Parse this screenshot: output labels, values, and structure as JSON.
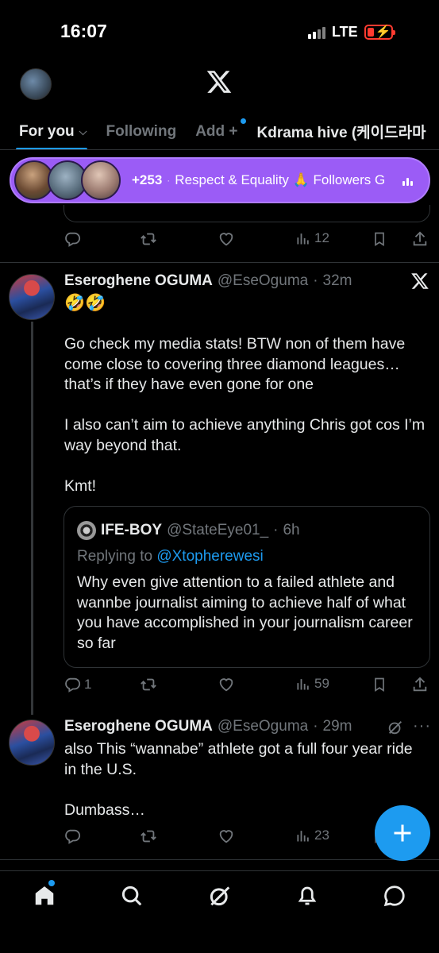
{
  "status_bar": {
    "time": "16:07",
    "network": "LTE"
  },
  "tabs": [
    {
      "label": "For you",
      "active": true
    },
    {
      "label": "Following"
    },
    {
      "label": "Add +"
    },
    {
      "label": "Kdrama hive (케이드라마"
    }
  ],
  "space_pill": {
    "count": "+253",
    "title": "Respect & Equality 🙏 Followers G"
  },
  "prev_tweet": {
    "views": "12"
  },
  "tweet1": {
    "name": "Eseroghene OGUMA",
    "handle": "@EseOguma",
    "time": "32m",
    "emojis": "🤣🤣",
    "body": "Go check my media stats! BTW non of them have come close to covering three diamond leagues… that’s if they have even gone for one\n\nI also can’t aim to achieve anything Chris got cos I’m way beyond that.\n\nKmt!",
    "replies": "1",
    "views": "59",
    "quote": {
      "name": "IFE-BOY",
      "handle": "@StateEye01_",
      "time": "6h",
      "replying_prefix": "Replying to",
      "replying_to": "@Xtopherewesi",
      "body": "Why even give attention to a failed athlete and wannbe journalist aiming to achieve half of what you have accomplished in your journalism career so far"
    }
  },
  "tweet2": {
    "name": "Eseroghene OGUMA",
    "handle": "@EseOguma",
    "time": "29m",
    "body": "also This “wannabe” athlete got a full four year ride in the U.S.\n\nDumbass…",
    "views": "23"
  },
  "colors": {
    "accent": "#1d9bf0",
    "background": "#000000",
    "muted": "#71767b",
    "space_pill": "#9b5cf6"
  }
}
